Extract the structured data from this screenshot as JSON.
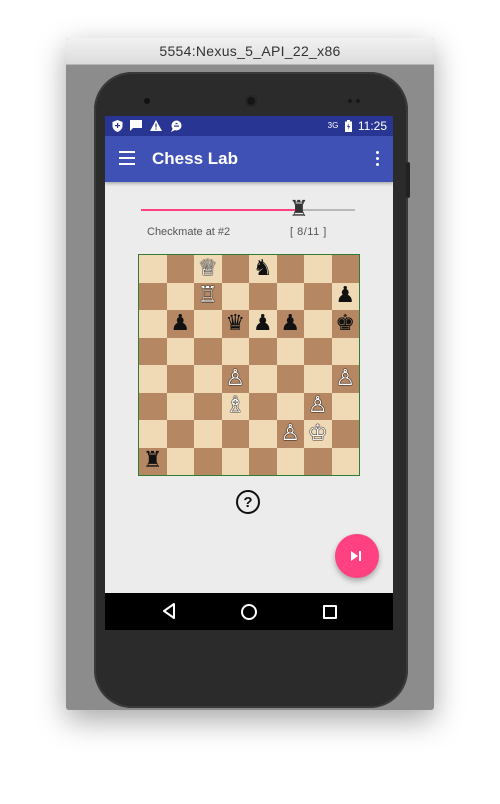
{
  "window": {
    "title": "5554:Nexus_5_API_22_x86"
  },
  "status_bar": {
    "icons": [
      "shield-icon",
      "message-icon",
      "warning-icon",
      "chat-icon",
      "network-3g-icon",
      "battery-icon"
    ],
    "network": "3G",
    "time": "11:25"
  },
  "app_bar": {
    "title": "Chess Lab",
    "menu_icon": "hamburger-menu-icon",
    "overflow_icon": "more-vert-icon"
  },
  "puzzle": {
    "label": "Checkmate at #2",
    "progress": "[ 8/11 ]",
    "slider_value": 8,
    "slider_max": 11,
    "slider_thumb_piece": "black-rook"
  },
  "board": {
    "rows": [
      [
        "",
        "",
        "♕",
        "",
        "♞",
        "",
        "",
        ""
      ],
      [
        "",
        "",
        "♖",
        "",
        "",
        "",
        "",
        "♟"
      ],
      [
        "",
        "♟",
        "",
        "♛",
        "♟",
        "♟",
        "",
        "♚"
      ],
      [
        "",
        "",
        "",
        "",
        "",
        "",
        "",
        ""
      ],
      [
        "",
        "",
        "",
        "♙",
        "",
        "",
        "",
        "♙"
      ],
      [
        "",
        "",
        "",
        "♗",
        "",
        "",
        "♙",
        ""
      ],
      [
        "",
        "",
        "",
        "",
        "",
        "♙",
        "♔",
        ""
      ],
      [
        "♜",
        "",
        "",
        "",
        "",
        "",
        "",
        ""
      ]
    ]
  },
  "help_icon": "question-circle-icon",
  "fab": {
    "icon": "skip-next-icon",
    "color": "#ff4081"
  },
  "colors": {
    "primary": "#3f51b5",
    "primary_dark": "#283593",
    "accent": "#ff4081",
    "board_light": "#f0d9b5",
    "board_dark": "#b58863"
  }
}
